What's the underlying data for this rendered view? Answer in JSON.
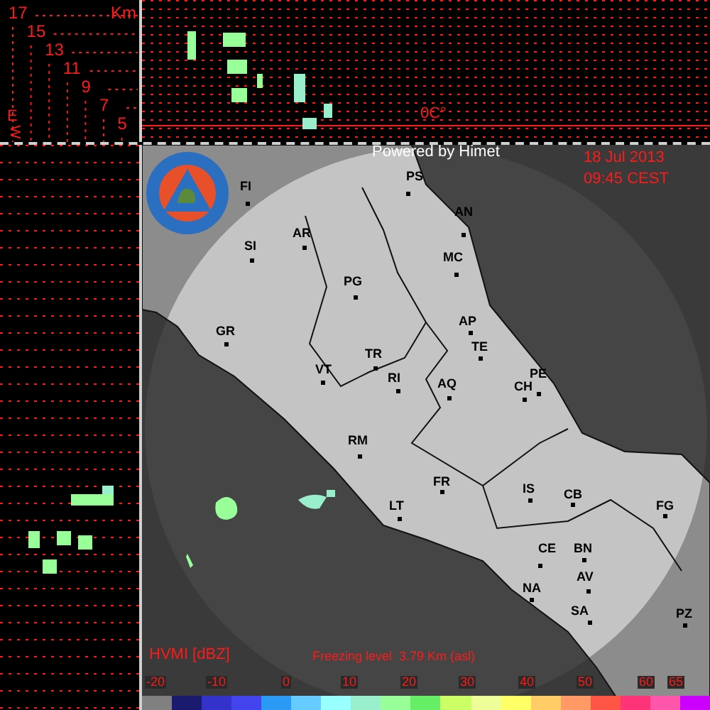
{
  "height_profile": {
    "unit": "Km",
    "ticks": [
      "17",
      "15",
      "13",
      "11",
      "9",
      "7",
      "5"
    ],
    "direction_labels": [
      "E",
      "W"
    ]
  },
  "freezing_marker": {
    "label": "0C°"
  },
  "map": {
    "credit": "Powered by Himet",
    "date": "18 Jul 2013",
    "time": "09:45 CEST",
    "cities": [
      "FI",
      "SI",
      "AR",
      "PS",
      "AN",
      "MC",
      "PG",
      "AP",
      "TE",
      "GR",
      "TR",
      "VT",
      "RI",
      "AQ",
      "PE",
      "CH",
      "RM",
      "FR",
      "LT",
      "IS",
      "CB",
      "FG",
      "CE",
      "BN",
      "AV",
      "NA",
      "SA",
      "PZ"
    ]
  },
  "legend": {
    "title": "HVMI [dBZ]",
    "freezing_level": "Freezing level  3.79 Km (asl)",
    "ticks": [
      "-20",
      "-10",
      "0",
      "10",
      "20",
      "30",
      "40",
      "50",
      "60",
      "65"
    ],
    "swatches": [
      {
        "color": "#808080"
      },
      {
        "color": "#1a1a6e"
      },
      {
        "color": "#3333cc"
      },
      {
        "color": "#4444ee"
      },
      {
        "color": "#2a9af5"
      },
      {
        "color": "#66ccff"
      },
      {
        "color": "#99ffff"
      },
      {
        "color": "#99eecc"
      },
      {
        "color": "#99ff99"
      },
      {
        "color": "#66ee66"
      },
      {
        "color": "#ccff66"
      },
      {
        "color": "#eeff99"
      },
      {
        "color": "#ffff66"
      },
      {
        "color": "#ffcc66"
      },
      {
        "color": "#ff9966"
      },
      {
        "color": "#ff5544"
      },
      {
        "color": "#ff3377"
      },
      {
        "color": "#ff55aa"
      },
      {
        "color": "#cc00ff"
      }
    ]
  }
}
